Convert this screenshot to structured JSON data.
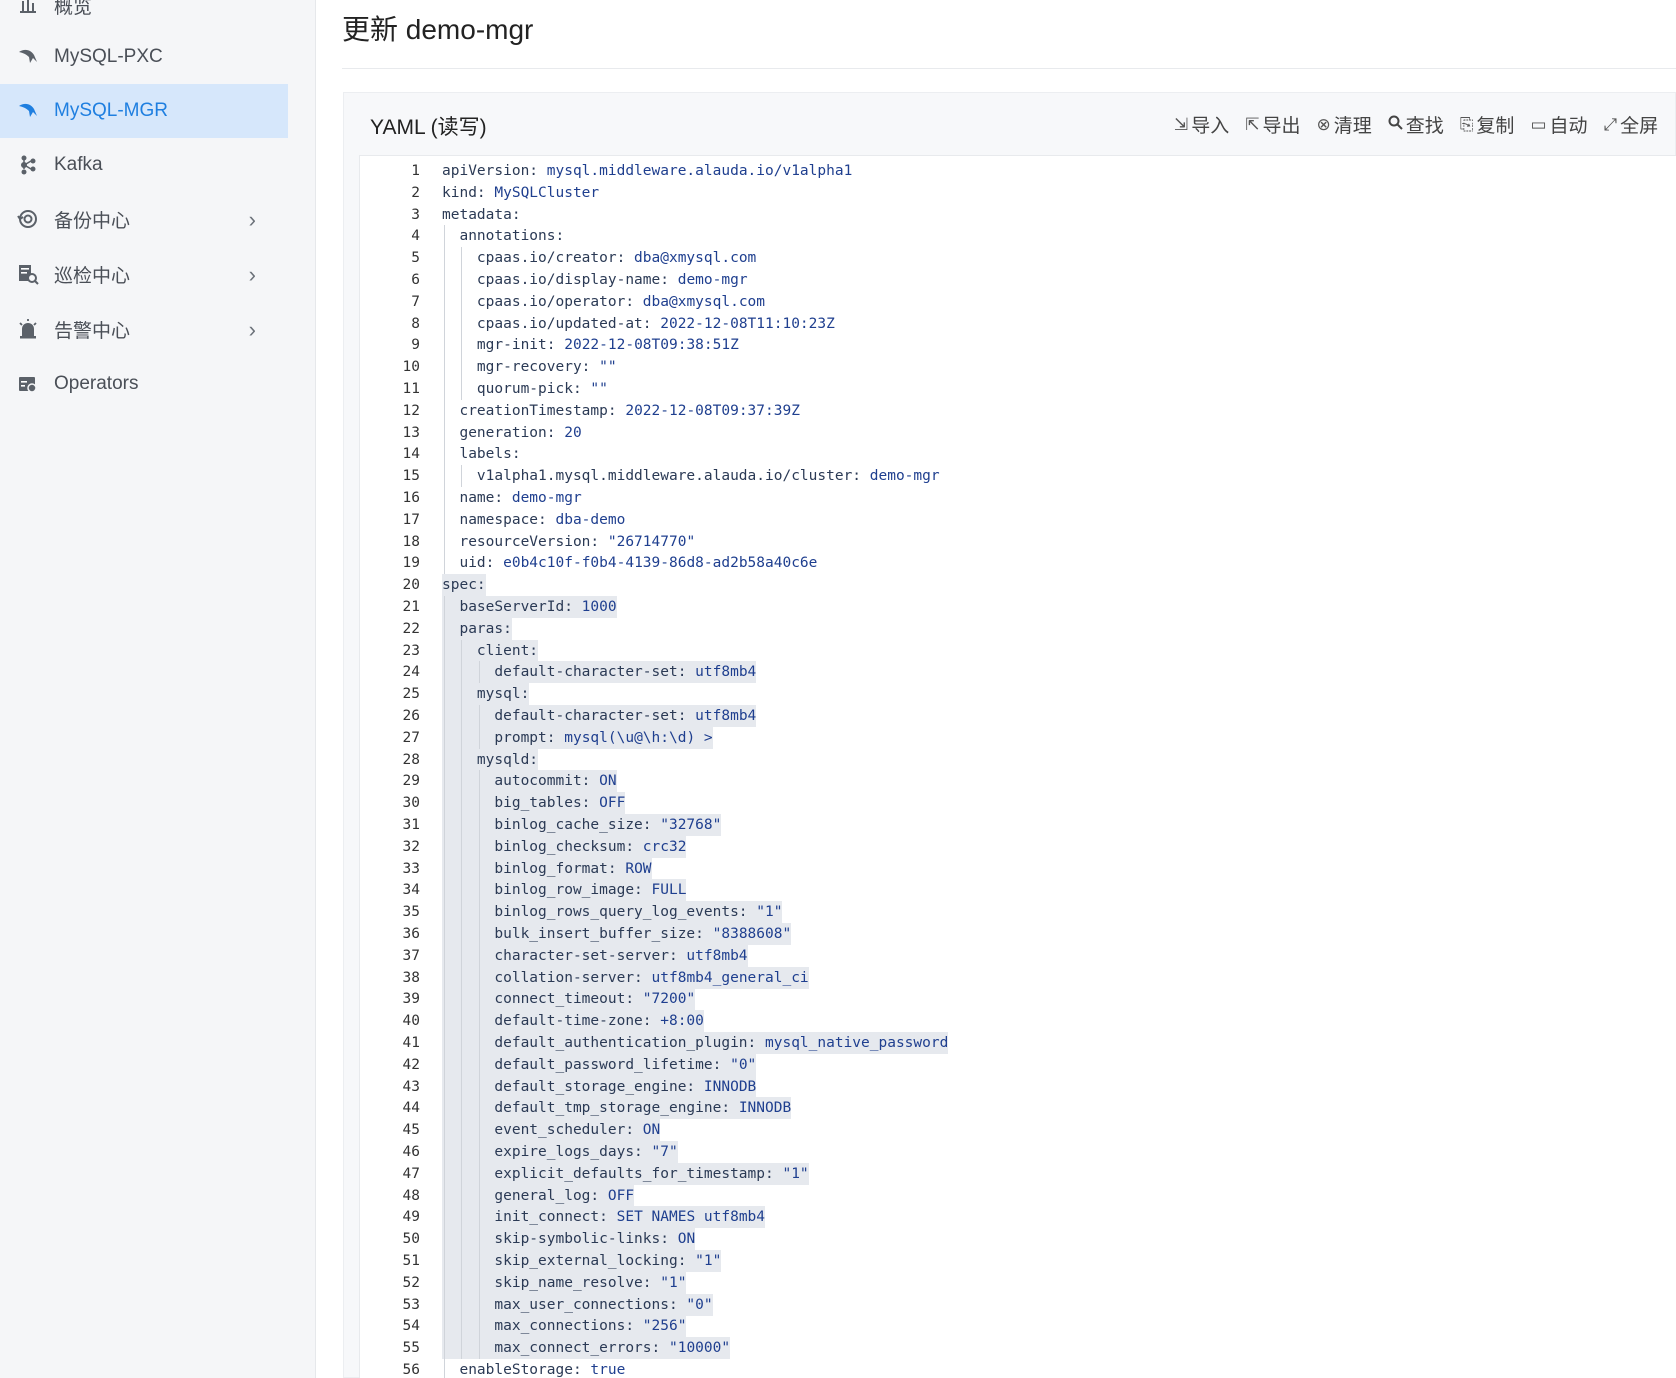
{
  "sidebar": {
    "items": [
      {
        "label": "概览",
        "icon": "bar-chart-icon",
        "active": false,
        "expandable": false
      },
      {
        "label": "MySQL-PXC",
        "icon": "dolphin-icon",
        "active": false,
        "expandable": false
      },
      {
        "label": "MySQL-MGR",
        "icon": "dolphin-icon",
        "active": true,
        "expandable": false
      },
      {
        "label": "Kafka",
        "icon": "kafka-icon",
        "active": false,
        "expandable": false
      },
      {
        "label": "备份中心",
        "icon": "backup-icon",
        "active": false,
        "expandable": true
      },
      {
        "label": "巡检中心",
        "icon": "inspect-icon",
        "active": false,
        "expandable": true
      },
      {
        "label": "告警中心",
        "icon": "alarm-icon",
        "active": false,
        "expandable": true
      },
      {
        "label": "Operators",
        "icon": "operators-icon",
        "active": false,
        "expandable": false
      }
    ]
  },
  "page": {
    "title": "更新 demo-mgr"
  },
  "panel": {
    "title": "YAML (读写)",
    "toolbar": [
      {
        "label": "导入",
        "icon": "import-icon"
      },
      {
        "label": "导出",
        "icon": "export-icon"
      },
      {
        "label": "清理",
        "icon": "clear-icon"
      },
      {
        "label": "查找",
        "icon": "search-icon"
      },
      {
        "label": "复制",
        "icon": "copy-icon"
      },
      {
        "label": "自动",
        "icon": "auto-icon"
      },
      {
        "label": "全屏",
        "icon": "fullscreen-icon"
      }
    ]
  },
  "colors": {
    "accent": "#1f7fe0",
    "active_bg": "#d6e7fb",
    "selection_bg": "#e6e9ee"
  },
  "editor": {
    "lines": [
      "apiVersion: mysql.middleware.alauda.io/v1alpha1",
      "kind: MySQLCluster",
      "metadata:",
      "  annotations:",
      "    cpaas.io/creator: dba@xmysql.com",
      "    cpaas.io/display-name: demo-mgr",
      "    cpaas.io/operator: dba@xmysql.com",
      "    cpaas.io/updated-at: 2022-12-08T11:10:23Z",
      "    mgr-init: 2022-12-08T09:38:51Z",
      "    mgr-recovery: \"\"",
      "    quorum-pick: \"\"",
      "  creationTimestamp: 2022-12-08T09:37:39Z",
      "  generation: 20",
      "  labels:",
      "    v1alpha1.mysql.middleware.alauda.io/cluster: demo-mgr",
      "  name: demo-mgr",
      "  namespace: dba-demo",
      "  resourceVersion: \"26714770\"",
      "  uid: e0b4c10f-f0b4-4139-86d8-ad2b58a40c6e",
      "spec:",
      "  baseServerId: 1000",
      "  paras:",
      "    client:",
      "      default-character-set: utf8mb4",
      "    mysql:",
      "      default-character-set: utf8mb4",
      "      prompt: mysql(\\u@\\h:\\d) >",
      "    mysqld:",
      "      autocommit: ON",
      "      big_tables: OFF",
      "      binlog_cache_size: \"32768\"",
      "      binlog_checksum: crc32",
      "      binlog_format: ROW",
      "      binlog_row_image: FULL",
      "      binlog_rows_query_log_events: \"1\"",
      "      bulk_insert_buffer_size: \"8388608\"",
      "      character-set-server: utf8mb4",
      "      collation-server: utf8mb4_general_ci",
      "      connect_timeout: \"7200\"",
      "      default-time-zone: +8:00",
      "      default_authentication_plugin: mysql_native_password",
      "      default_password_lifetime: \"0\"",
      "      default_storage_engine: INNODB",
      "      default_tmp_storage_engine: INNODB",
      "      event_scheduler: ON",
      "      expire_logs_days: \"7\"",
      "      explicit_defaults_for_timestamp: \"1\"",
      "      general_log: OFF",
      "      init_connect: SET NAMES utf8mb4",
      "      skip-symbolic-links: ON",
      "      skip_external_locking: \"1\"",
      "      skip_name_resolve: \"1\"",
      "      max_user_connections: \"0\"",
      "      max_connections: \"256\"",
      "      max_connect_errors: \"10000\"",
      "  enableStorage: true"
    ],
    "selection_start": 20,
    "selection_end": 55
  }
}
